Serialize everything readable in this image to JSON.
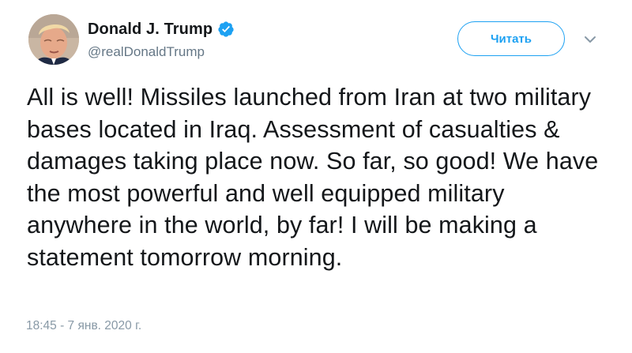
{
  "tweet": {
    "author": {
      "name": "Donald J. Trump",
      "handle": "@realDonaldTrump",
      "verified": true,
      "avatar_icon": "profile-photo"
    },
    "follow_button": {
      "label": "Читать"
    },
    "menu_icon": "chevron-down-icon",
    "text": "All is well! Missiles launched from Iran at two military bases located in Iraq. Assessment of casualties & damages taking place now. So far, so good! We have the most powerful and well equipped military anywhere in the world, by far! I will be making a statement tomorrow morning.",
    "timestamp": "18:45 - 7 янв. 2020 г."
  },
  "colors": {
    "accent": "#1da1f2",
    "text": "#14171a",
    "secondary_text": "#657786",
    "timestamp_text": "#8899a6"
  }
}
